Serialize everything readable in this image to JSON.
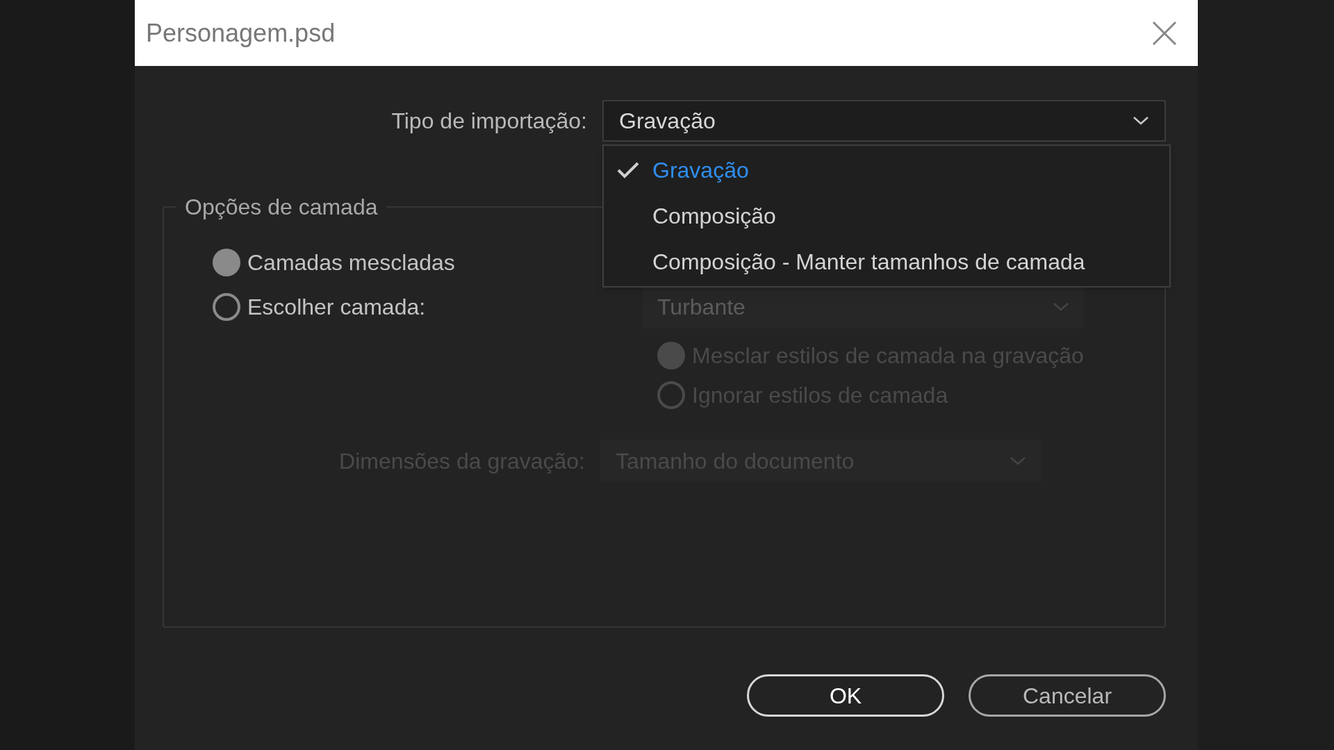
{
  "window": {
    "title": "Personagem.psd"
  },
  "import_type": {
    "label": "Tipo de importação:",
    "value": "Gravação",
    "expanded": true,
    "options": [
      {
        "label": "Gravação",
        "selected": true
      },
      {
        "label": "Composição",
        "selected": false
      },
      {
        "label": "Composição - Manter tamanhos de camada",
        "selected": false
      }
    ]
  },
  "layer_options": {
    "title": "Opções de camada",
    "choices": [
      {
        "label": "Camadas mescladas",
        "selected": true,
        "disabled": false
      },
      {
        "label": "Escolher camada:",
        "selected": false,
        "disabled": false
      }
    ],
    "layer_select": {
      "value": "Turbante",
      "disabled": true
    },
    "style_choices": [
      {
        "label": "Mesclar estilos de camada na gravação",
        "selected": true,
        "disabled": true
      },
      {
        "label": "Ignorar estilos de camada",
        "selected": false,
        "disabled": true
      }
    ],
    "dimensions": {
      "label": "Dimensões da gravação:",
      "value": "Tamanho do documento",
      "disabled": true
    }
  },
  "buttons": [
    {
      "label": "OK",
      "default": true
    },
    {
      "label": "Cancelar",
      "default": false
    }
  ]
}
